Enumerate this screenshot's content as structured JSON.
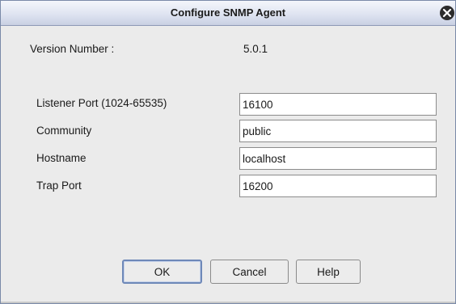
{
  "window": {
    "title": "Configure SNMP Agent"
  },
  "info": {
    "version_label": "Version Number :",
    "version_value": "5.0.1"
  },
  "form": {
    "listener_port_label": "Listener Port (1024-65535)",
    "listener_port_value": "16100",
    "community_label": "Community",
    "community_value": "public",
    "hostname_label": "Hostname",
    "hostname_value": "localhost",
    "trap_port_label": "Trap Port",
    "trap_port_value": "16200"
  },
  "buttons": {
    "ok": "OK",
    "cancel": "Cancel",
    "help": "Help"
  },
  "icons": {
    "close": "close-icon"
  },
  "colors": {
    "title_bar": "#dfe4f1",
    "dialog_background": "#ebebeb",
    "default_button_border": "#6e88b8"
  }
}
